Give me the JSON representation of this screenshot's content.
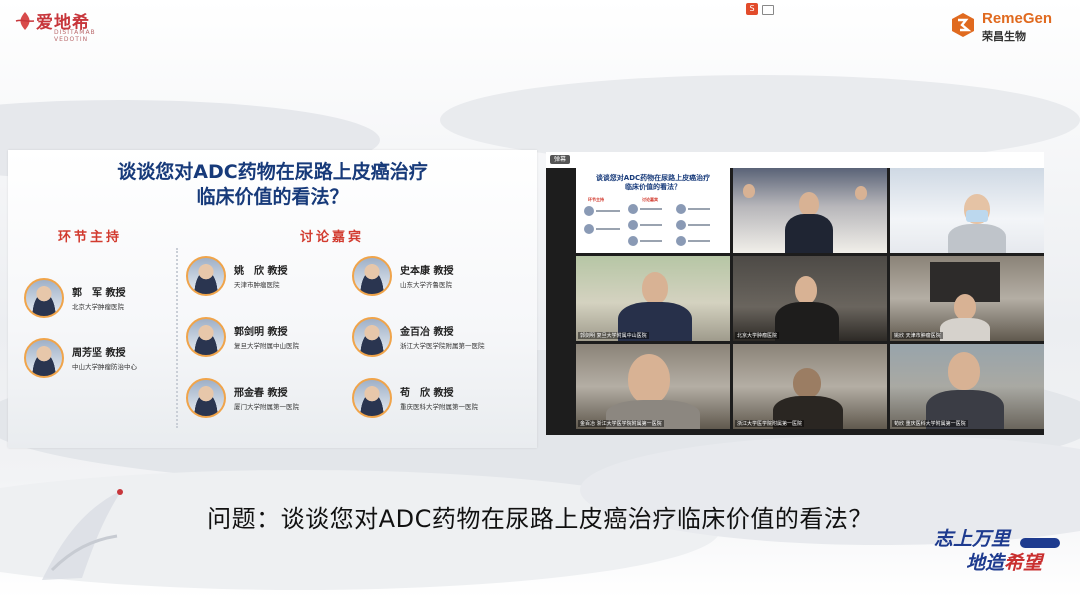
{
  "logos": {
    "left_brand": "爱地希",
    "left_sub": "DISITAMAB VEDOTIN",
    "right_brand": "RemeGen",
    "right_cn": "荣昌生物"
  },
  "topbar": {
    "icon_char": "S"
  },
  "slide": {
    "title_line1": "谈谈您对ADC药物在尿路上皮癌治疗",
    "title_line2": "临床价值的看法？",
    "hosts_heading": "环节主持",
    "guests_heading": "讨论嘉宾",
    "hosts": [
      {
        "name": "郭　军",
        "title": "教授",
        "affiliation": "北京大学肿瘤医院"
      },
      {
        "name": "周芳坚",
        "title": "教授",
        "affiliation": "中山大学肿瘤防治中心"
      }
    ],
    "guests": [
      {
        "name": "姚　欣",
        "title": "教授",
        "affiliation": "天津市肿瘤医院"
      },
      {
        "name": "史本康",
        "title": "教授",
        "affiliation": "山东大学齐鲁医院"
      },
      {
        "name": "郭剑明",
        "title": "教授",
        "affiliation": "复旦大学附属中山医院"
      },
      {
        "name": "金百冶",
        "title": "教授",
        "affiliation": "浙江大学医学院附属第一医院"
      },
      {
        "name": "邢金春",
        "title": "教授",
        "affiliation": "厦门大学附属第一医院"
      },
      {
        "name": "苟　欣",
        "title": "教授",
        "affiliation": "重庆医科大学附属第一医院"
      }
    ]
  },
  "video": {
    "top_button": "弹幕",
    "shared_title_line1": "谈谈您对ADC药物在尿路上皮癌治疗",
    "shared_title_line2": "临床价值的看法？",
    "shared_hosts_heading": "环节主持",
    "shared_guests_heading": "讨论嘉宾",
    "tiles": [
      {
        "label": ""
      },
      {
        "label": ""
      },
      {
        "label": ""
      },
      {
        "label": "郭剑明 复旦大学附属中山医院"
      },
      {
        "label": "北京大学肿瘤医院"
      },
      {
        "label": "姚欣 天津市肿瘤医院"
      },
      {
        "label": "金百冶 浙江大学医学院附属第一医院"
      },
      {
        "label": "浙江大学医学院附属第一医院"
      },
      {
        "label": "苟欣 重庆医科大学附属第一医院"
      }
    ]
  },
  "subtitle": "问题：谈谈您对ADC药物在尿路上皮癌治疗临床价值的看法？",
  "slogan": {
    "line1": "志上万里",
    "line2_a": "地造",
    "line2_b": "希望"
  },
  "colors": {
    "title_blue": "#173a7a",
    "section_red": "#d23b2f",
    "brand_red": "#c7363b",
    "brand_orange": "#e06a1f"
  }
}
